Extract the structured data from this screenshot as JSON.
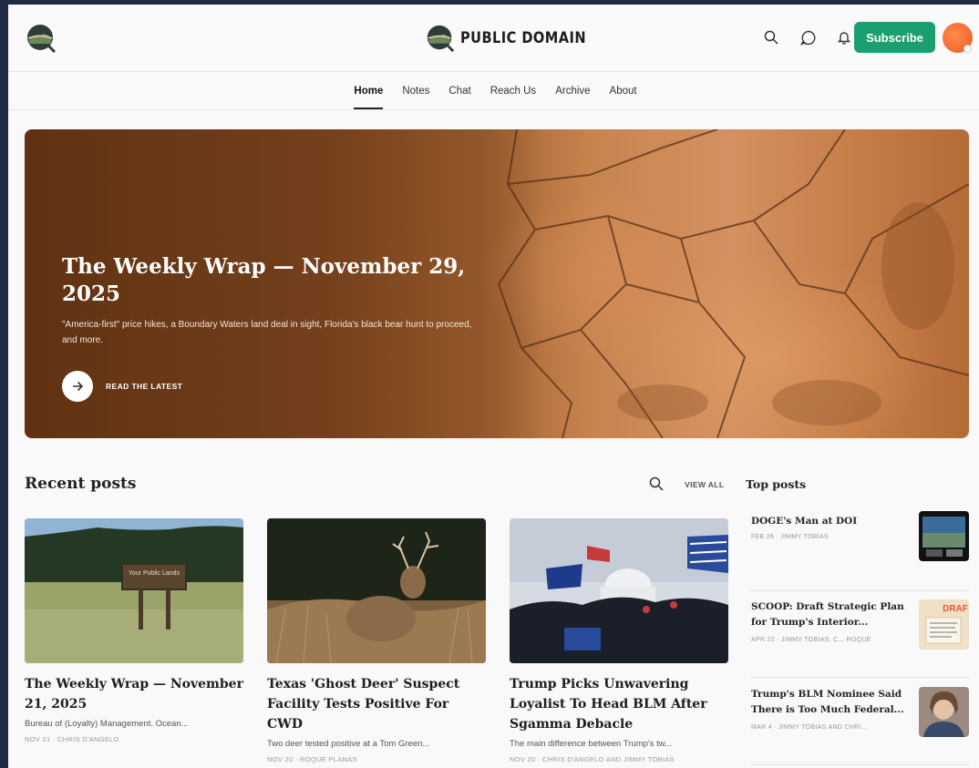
{
  "header": {
    "brand_name": "PUBLIC DOMAIN",
    "subscribe_label": "Subscribe"
  },
  "nav": {
    "items": [
      "Home",
      "Notes",
      "Chat",
      "Reach Us",
      "Archive",
      "About"
    ],
    "active": "Home"
  },
  "hero": {
    "title": "The Weekly Wrap — November 29, 2025",
    "description": "\"America-first\" price hikes, a Boundary Waters land deal in sight, Florida's black bear hunt to proceed, and more.",
    "cta_label": "READ THE LATEST"
  },
  "recent": {
    "title": "Recent posts",
    "view_all_label": "VIEW ALL",
    "posts": [
      {
        "title": "The Weekly Wrap — November 21, 2025",
        "subtitle": "Bureau of (Loyalty) Management. Ocean...",
        "meta": "NOV 21 · CHRIS D'ANGELO",
        "sign_text": "Your Public Lands"
      },
      {
        "title": "Texas 'Ghost Deer' Suspect Facility Tests Positive For CWD",
        "subtitle": "Two deer tested positive at a Tom Green...",
        "meta": "NOV 20 · ROQUE PLANAS"
      },
      {
        "title": "Trump Picks Unwavering Loyalist To Head BLM After Sgamma Debacle",
        "subtitle": "The main difference between Trump's tw...",
        "meta": "NOV 20 · CHRIS D'ANGELO AND JIMMY TOBIAS"
      }
    ]
  },
  "top": {
    "title": "Top posts",
    "posts": [
      {
        "title": "DOGE's Man at DOI",
        "meta": "FEB 26 · JIMMY TOBIAS"
      },
      {
        "title": "SCOOP: Draft Strategic Plan for Trump's Interior...",
        "meta": "APR 22 · JIMMY TOBIAS, C... ROQUE",
        "thumb_text": "DRAF"
      },
      {
        "title": "Trump's BLM Nominee Said There is Too Much Federal...",
        "meta": "MAR 4 · JIMMY TOBIAS AND CHRI..."
      }
    ]
  },
  "colors": {
    "accent": "#1aa06e",
    "avatar": "#f26a2e"
  }
}
